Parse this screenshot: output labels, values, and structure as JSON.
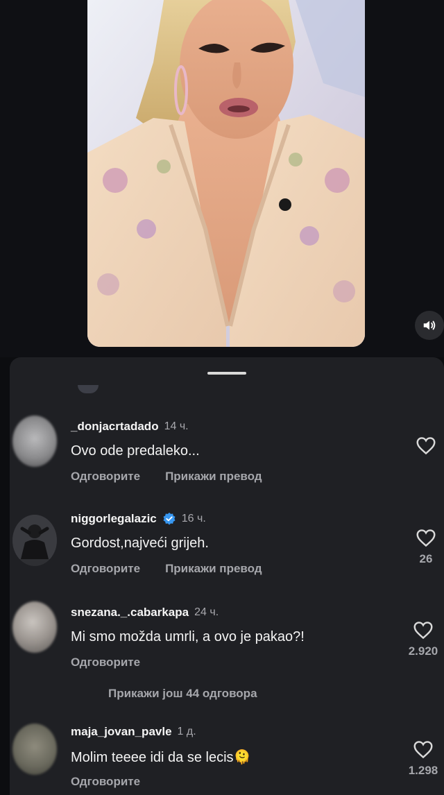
{
  "video": {
    "mute_icon": "speaker-volume-icon"
  },
  "comments": [
    {
      "username": "_donjacrtadado",
      "time": "14 ч.",
      "text": "Ovo ode predaleko...",
      "reply": "Одговорите",
      "translate": "Прикажи превод",
      "likes": ""
    },
    {
      "username": "niggorlegalazic",
      "verified": true,
      "time": "16 ч.",
      "text": "Gordost,najveći grijeh.",
      "reply": "Одговорите",
      "translate": "Прикажи превод",
      "likes": "26"
    },
    {
      "username": "snezana._.cabarkapa",
      "time": "24 ч.",
      "text": "Mi smo možda umrli, a ovo je pakao?!",
      "reply": "Одговорите",
      "likes": "2.920"
    },
    {
      "username": "maja_jovan_pavle",
      "time": "1 д.",
      "text": "Molim teeee idi da se lecis🫠",
      "reply": "Одговорите",
      "likes": "1.298"
    }
  ],
  "view_more_replies": "Прикажи још 44 одговора",
  "colors": {
    "background": "#0c0d10",
    "sheet": "#1f2024",
    "verified_blue": "#3897f0",
    "secondary_text": "#a6a7ac"
  }
}
